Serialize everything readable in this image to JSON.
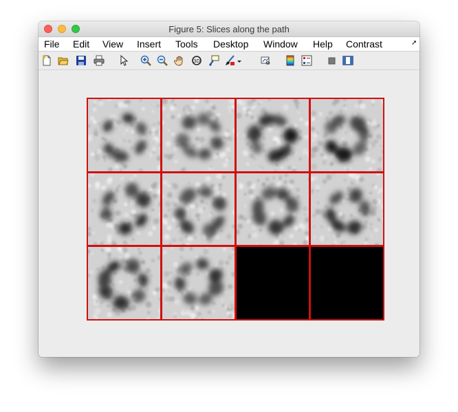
{
  "window": {
    "title": "Figure 5: Slices along the path"
  },
  "menu": {
    "items": [
      "File",
      "Edit",
      "View",
      "Insert",
      "Tools",
      "Desktop",
      "Window",
      "Help",
      "Contrast"
    ]
  },
  "toolbar": {
    "icons": [
      "new-file-icon",
      "open-folder-icon",
      "save-icon",
      "print-icon",
      "pointer-icon",
      "zoom-in-icon",
      "zoom-out-icon",
      "pan-hand-icon",
      "rotate-3d-icon",
      "data-cursor-icon",
      "brush-icon",
      "link-plot-icon",
      "colorbar-icon",
      "legend-icon",
      "hide-plot-tools-icon",
      "show-plot-tools-icon"
    ]
  },
  "montage": {
    "rows": 3,
    "cols": 4,
    "frame_color": "#d01010",
    "slices": 10,
    "empty_fill": "#000000"
  }
}
